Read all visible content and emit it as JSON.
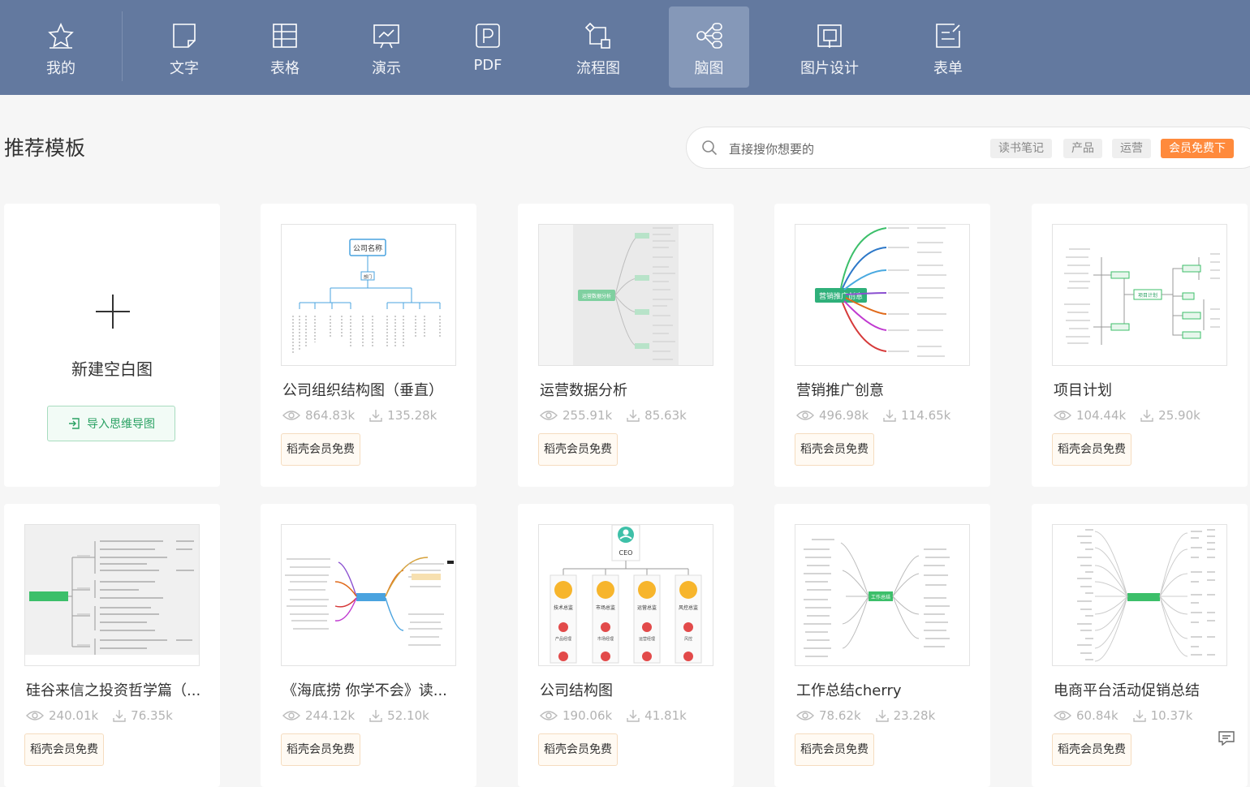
{
  "nav": {
    "items": [
      {
        "label": "我的",
        "icon": "star-icon"
      },
      {
        "label": "文字",
        "icon": "document-icon"
      },
      {
        "label": "表格",
        "icon": "table-icon"
      },
      {
        "label": "演示",
        "icon": "presentation-icon"
      },
      {
        "label": "PDF",
        "icon": "pdf-icon"
      },
      {
        "label": "流程图",
        "icon": "flowchart-icon"
      },
      {
        "label": "脑图",
        "icon": "mindmap-icon",
        "active": true
      },
      {
        "label": "图片设计",
        "icon": "image-design-icon"
      },
      {
        "label": "表单",
        "icon": "form-icon"
      }
    ]
  },
  "header": {
    "title": "推荐模板",
    "search_placeholder": "直接搜你想要的",
    "tags": [
      "读书笔记",
      "产品",
      "运营",
      "会员免费下"
    ]
  },
  "new_blank": {
    "label": "新建空白图",
    "import_label": "导入思维导图"
  },
  "cards": [
    {
      "title": "公司组织结构图（垂直）",
      "views": "864.83k",
      "downloads": "135.28k",
      "badge": "稻壳会员免费"
    },
    {
      "title": "运营数据分析",
      "views": "255.91k",
      "downloads": "85.63k",
      "badge": "稻壳会员免费",
      "thumb_label": "运营数据分析"
    },
    {
      "title": "营销推广创意",
      "views": "496.98k",
      "downloads": "114.65k",
      "badge": "稻壳会员免费",
      "thumb_label": "营销推广创意"
    },
    {
      "title": "项目计划",
      "views": "104.44k",
      "downloads": "25.90k",
      "badge": "稻壳会员免费",
      "thumb_label": "项目计划"
    },
    {
      "title": "硅谷来信之投资哲学篇（...",
      "views": "240.01k",
      "downloads": "76.35k",
      "badge": "稻壳会员免费"
    },
    {
      "title": "《海底捞 你学不会》读...",
      "views": "244.12k",
      "downloads": "52.10k",
      "badge": "稻壳会员免费"
    },
    {
      "title": "公司结构图",
      "views": "190.06k",
      "downloads": "41.81k",
      "badge": "稻壳会员免费"
    },
    {
      "title": "工作总结cherry",
      "views": "78.62k",
      "downloads": "23.28k",
      "badge": "稻壳会员免费",
      "thumb_label": "工作总结"
    },
    {
      "title": "电商平台活动促销总结",
      "views": "60.84k",
      "downloads": "10.37k",
      "badge": "稻壳会员免费"
    }
  ],
  "thumb_org": {
    "root": "公司名称",
    "sub": "部门"
  },
  "thumb_ceo": {
    "root": "CEO",
    "heads": [
      "技术总监",
      "市场总监",
      "运营总监",
      "风控总监"
    ],
    "managers": [
      "产品经理",
      "市场经理",
      "运营经理",
      "风控"
    ]
  },
  "colors": {
    "nav_bg": "#63799f",
    "nav_active": "#8598b8",
    "accent_orange": "#ff8a3c",
    "accent_green": "#2aa163"
  }
}
